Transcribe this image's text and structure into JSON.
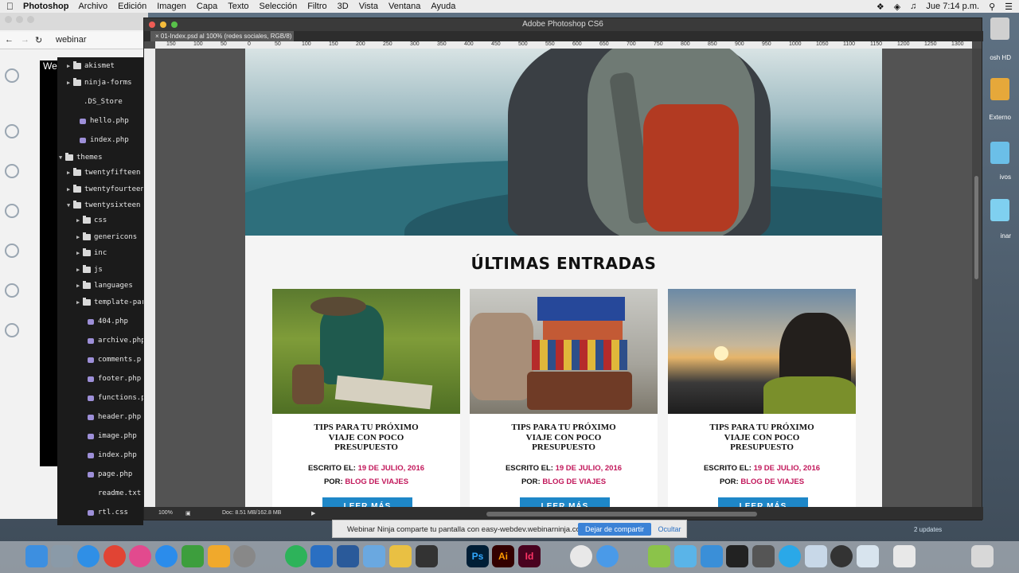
{
  "menubar": {
    "app_name": "Photoshop",
    "menus": [
      "Archivo",
      "Edición",
      "Imagen",
      "Capa",
      "Texto",
      "Selección",
      "Filtro",
      "3D",
      "Vista",
      "Ventana",
      "Ayuda"
    ],
    "clock": "Jue 7:14 p.m."
  },
  "browser": {
    "tab_label": "webinar",
    "partial_label": "We"
  },
  "file_tree": {
    "items": [
      {
        "label": "akismet",
        "type": "folder"
      },
      {
        "label": "ninja-forms",
        "type": "folder"
      },
      {
        "label": ".DS_Store",
        "type": "file"
      },
      {
        "label": "hello.php",
        "type": "php"
      },
      {
        "label": "index.php",
        "type": "php"
      },
      {
        "label": "themes",
        "type": "folder-open"
      },
      {
        "label": "twentyfifteen",
        "type": "folder"
      },
      {
        "label": "twentyfourteen",
        "type": "folder"
      },
      {
        "label": "twentysixteen",
        "type": "folder-open"
      },
      {
        "label": "css",
        "type": "folder"
      },
      {
        "label": "genericons",
        "type": "folder"
      },
      {
        "label": "inc",
        "type": "folder"
      },
      {
        "label": "js",
        "type": "folder"
      },
      {
        "label": "languages",
        "type": "folder"
      },
      {
        "label": "template-par",
        "type": "folder"
      },
      {
        "label": "404.php",
        "type": "php"
      },
      {
        "label": "archive.php",
        "type": "php"
      },
      {
        "label": "comments.p",
        "type": "php"
      },
      {
        "label": "footer.php",
        "type": "php"
      },
      {
        "label": "functions.ph",
        "type": "php"
      },
      {
        "label": "header.php",
        "type": "php"
      },
      {
        "label": "image.php",
        "type": "php"
      },
      {
        "label": "index.php",
        "type": "php"
      },
      {
        "label": "page.php",
        "type": "php"
      },
      {
        "label": "readme.txt",
        "type": "file"
      },
      {
        "label": "rtl.css",
        "type": "php"
      }
    ]
  },
  "photoshop": {
    "window_title": "Adobe Photoshop CS6",
    "doc_tab": "01-Index.psd al 100% (redes sociales, RGB/8)",
    "ruler_ticks": [
      "150",
      "100",
      "50",
      "0",
      "50",
      "100",
      "150",
      "200",
      "250",
      "300",
      "350",
      "400",
      "450",
      "500",
      "550",
      "600",
      "650",
      "700",
      "750",
      "800",
      "850",
      "900",
      "950",
      "1000",
      "1050",
      "1100",
      "1150",
      "1200",
      "1250",
      "1300"
    ],
    "zoom": "100%",
    "doc_size": "Doc: 8.51 MB/162.8 MB"
  },
  "design": {
    "section_title": "ÚLTIMAS ENTRADAS",
    "cards": [
      {
        "title": "TIPS PARA TU PRÓXIMO VIAJE  CON POCO PRESUPUESTO",
        "written_label": "ESCRITO EL:",
        "date": "19 DE JULIO, 2016",
        "by_label": "POR:",
        "author": "BLOG DE VIAJES",
        "button": "LEER MÁS"
      },
      {
        "title": "TIPS PARA TU PRÓXIMO VIAJE  CON POCO PRESUPUESTO",
        "written_label": "ESCRITO EL:",
        "date": "19 DE JULIO, 2016",
        "by_label": "POR:",
        "author": "BLOG DE VIAJES",
        "button": "LEER MÁS"
      },
      {
        "title": "TIPS PARA TU PRÓXIMO VIAJE  CON POCO PRESUPUESTO",
        "written_label": "ESCRITO EL:",
        "date": "19 DE JULIO, 2016",
        "by_label": "POR:",
        "author": "BLOG DE VIAJES",
        "button": "LEER MÁS"
      }
    ],
    "accent_color": "#c2185b",
    "button_color": "#1e87c8"
  },
  "sharebar": {
    "message": "Webinar Ninja comparte tu pantalla con easy-webdev.webinarninja.co.",
    "stop_label": "Dejar de compartir",
    "hide_label": "Ocultar"
  },
  "desktop": {
    "updates": "2 updates",
    "labels": [
      "osh HD",
      "Externo",
      "ivos",
      "inar"
    ]
  },
  "dock": {
    "apps": [
      "finder-icon",
      "launchpad-icon",
      "safari-icon",
      "chrome-icon",
      "itunes-icon",
      "appstore-icon",
      "evernote-icon",
      "sketch-icon",
      "preferences-icon",
      "sourcetree-icon",
      "vscode-icon",
      "xcode-icon",
      "virtualbox-icon",
      "sequel-icon",
      "brackets-icon",
      "Ps",
      "Ai",
      "Id",
      "github-icon",
      "mail-icon",
      "android-icon",
      "coda-icon",
      "transmit-icon",
      "terminal-icon",
      "screenflow-icon",
      "skype-icon",
      "preview-icon",
      "obs-icon",
      "folder-icon",
      "keyboard-icon",
      "trash-icon"
    ]
  }
}
